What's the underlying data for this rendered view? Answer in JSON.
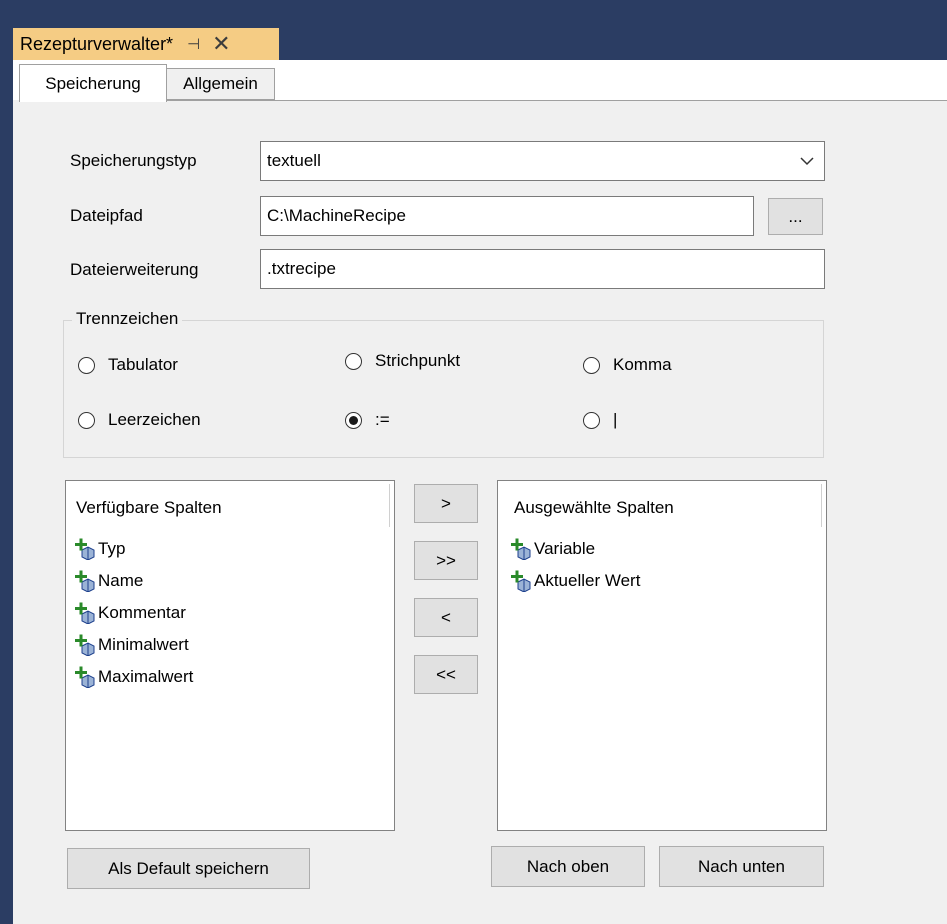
{
  "window": {
    "tab_title": "Rezepturverwalter*",
    "pin_glyph": "⊣",
    "close_glyph": "✕"
  },
  "tabs": [
    {
      "label": "Speicherung"
    },
    {
      "label": "Allgemein"
    }
  ],
  "form": {
    "storage_type_label": "Speicherungstyp",
    "storage_type_value": "textuell",
    "filepath_label": "Dateipfad",
    "filepath_value": "C:\\MachineRecipe",
    "browse_label": "...",
    "extension_label": "Dateierweiterung",
    "extension_value": ".txtrecipe"
  },
  "separator": {
    "group_label": "Trennzeichen",
    "options": [
      {
        "label": "Tabulator",
        "checked": false
      },
      {
        "label": "Strichpunkt",
        "checked": false
      },
      {
        "label": "Komma",
        "checked": false
      },
      {
        "label": "Leerzeichen",
        "checked": false
      },
      {
        "label": ":=",
        "checked": true
      },
      {
        "label": "|",
        "checked": false
      }
    ]
  },
  "available_columns": {
    "header": "Verfügbare Spalten",
    "items": [
      {
        "label": "Typ"
      },
      {
        "label": "Name"
      },
      {
        "label": "Kommentar"
      },
      {
        "label": "Minimalwert"
      },
      {
        "label": "Maximalwert"
      }
    ]
  },
  "transfer_buttons": {
    "add": ">",
    "add_all": ">>",
    "remove": "<",
    "remove_all": "<<"
  },
  "selected_columns": {
    "header": "Ausgewählte Spalten",
    "items": [
      {
        "label": "Variable"
      },
      {
        "label": "Aktueller Wert"
      }
    ]
  },
  "bottom_buttons": {
    "save_default": "Als Default speichern",
    "move_up": "Nach oben",
    "move_down": "Nach unten"
  },
  "colors": {
    "titlebar": "#2b3d63",
    "active_doc_tab": "#f5cc84",
    "panel_bg": "#f0f0f0"
  }
}
